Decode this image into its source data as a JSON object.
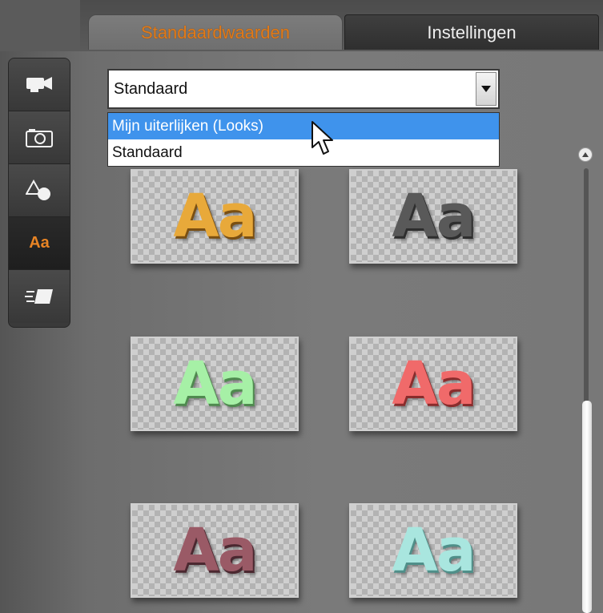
{
  "tabs": [
    {
      "label": "Standaardwaarden",
      "active": true
    },
    {
      "label": "Instellingen",
      "active": false
    }
  ],
  "toolbar": {
    "items": [
      {
        "icon": "video-camera-icon"
      },
      {
        "icon": "photo-camera-icon"
      },
      {
        "icon": "shapes-icon"
      },
      {
        "icon": "text-aa-icon",
        "label": "Aa",
        "active": true
      },
      {
        "icon": "motion-titles-icon"
      }
    ]
  },
  "dropdown": {
    "value": "Standaard",
    "options": [
      "Mijn uiterlijken (Looks)",
      "Standaard"
    ],
    "highlighted_index": 0
  },
  "looks": {
    "items": [
      {
        "text": "Aa",
        "fill": "#e8a93a",
        "shadow": "#7a4f12"
      },
      {
        "text": "Aa",
        "fill": "#595959",
        "shadow": "#2e2e2e"
      },
      {
        "text": "Aa",
        "fill": "#a6f0a6",
        "shadow": "#4f8a4f"
      },
      {
        "text": "Aa",
        "fill": "#f06a6a",
        "shadow": "#8a2c2c"
      },
      {
        "text": "Aa",
        "fill": "#9a5a66",
        "shadow": "#4b2830"
      },
      {
        "text": "Aa",
        "fill": "#a9e6df",
        "shadow": "#4f8f89"
      }
    ]
  }
}
